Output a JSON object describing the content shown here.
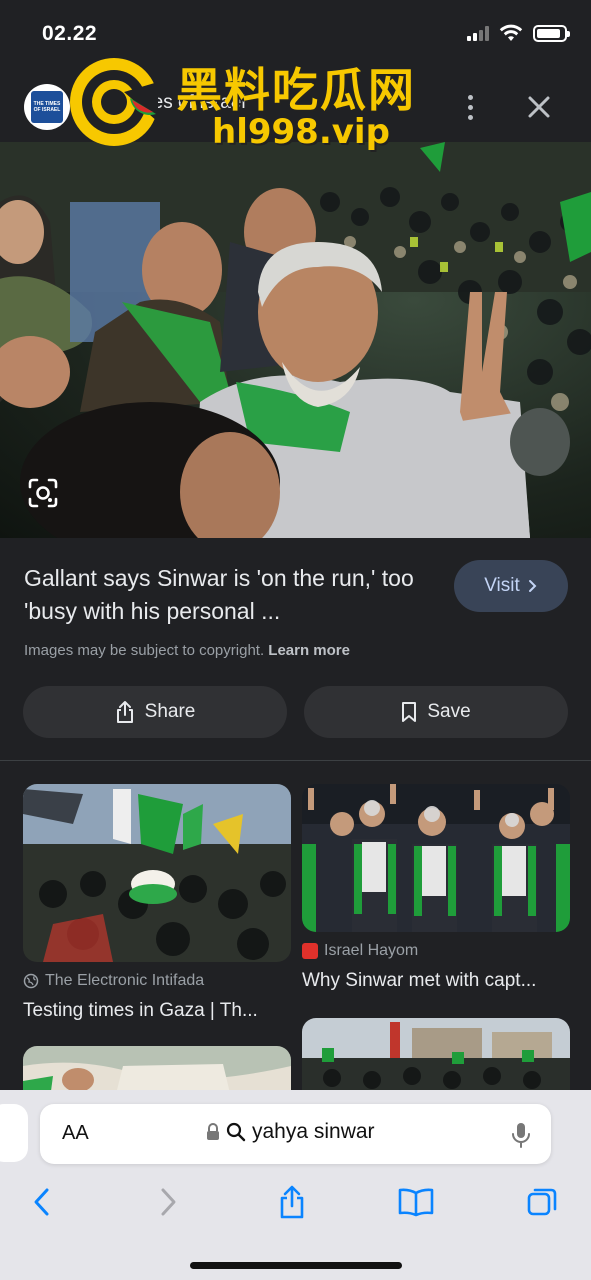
{
  "status_bar": {
    "time": "02.22",
    "battery_level": 0.9
  },
  "source_header": {
    "logo_text": "THE TIMES OF ISRAEL",
    "name": "The Times of Israel",
    "more_icon": "more-vert-icon",
    "close_icon": "close-icon"
  },
  "watermark": {
    "title": "黑料吃瓜网",
    "url": "hl998.vip"
  },
  "main_image": {
    "lens_icon": "lens-icon"
  },
  "result": {
    "title": "Gallant says Sinwar is 'on the run,' too 'busy with his personal ...",
    "visit_label": "Visit",
    "copyright_text": "Images may be subject to copyright.",
    "learn_more": "Learn more",
    "share_label": "Share",
    "save_label": "Save"
  },
  "related": [
    {
      "source": "The Electronic Intifada",
      "title": "Testing times in Gaza | Th..."
    },
    {
      "source": "Israel Hayom",
      "title": "Why Sinwar met with capt..."
    }
  ],
  "browser": {
    "aa_label": "AA",
    "url_text": "yahya sinwar",
    "icons": [
      "back-icon",
      "forward-icon",
      "share-icon",
      "bookmarks-icon",
      "tabs-icon"
    ]
  },
  "colors": {
    "background": "#202124",
    "accent_button": "#394457",
    "flag_green": "#1f9d3a",
    "watermark_yellow": "#f7c800",
    "ios_blue": "#0a84ff"
  }
}
